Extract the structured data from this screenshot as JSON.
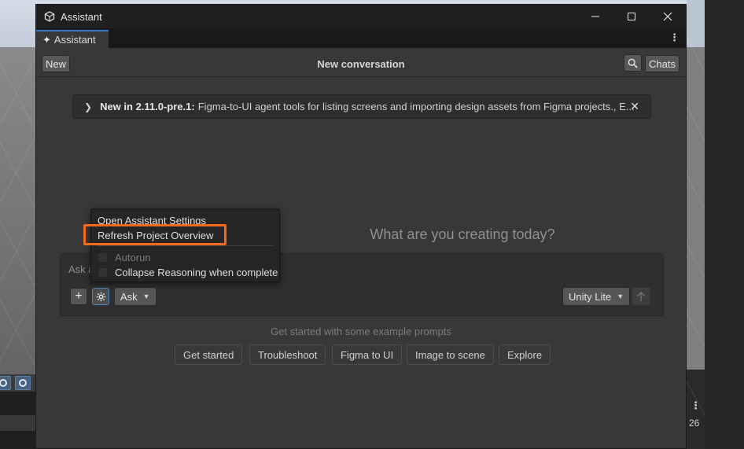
{
  "window": {
    "title": "Assistant",
    "app_icon": "unity-icon",
    "controls": [
      "minimize-icon",
      "maximize-icon",
      "close-icon"
    ]
  },
  "tab": {
    "label": "Assistant",
    "icon": "sparkle-icon",
    "menu_icon": "kebab-menu-icon"
  },
  "header": {
    "new_label": "New",
    "title": "New conversation",
    "search_icon": "search-icon",
    "chats_label": "Chats"
  },
  "notice": {
    "bold": "New in 2.11.0-pre.1:",
    "text": "Figma-to-UI agent tools for listing screens and importing design assets from Figma projects., E...",
    "expand_icon": "chevron-right-icon",
    "close_icon": "close-icon"
  },
  "headline": "What are you creating today?",
  "composer": {
    "placeholder": "Ask a",
    "add_icon": "plus-icon",
    "settings_icon": "gear-icon",
    "mode": "Ask",
    "model": "Unity Lite",
    "send_icon": "arrow-up-icon"
  },
  "examples": {
    "label": "Get started with some example prompts",
    "buttons": [
      "Get started",
      "Troubleshoot",
      "Figma to UI",
      "Image to scene",
      "Explore"
    ]
  },
  "menu": {
    "items": [
      "Open Assistant Settings",
      "Refresh Project Overview"
    ],
    "checks": [
      {
        "label": "Autorun",
        "enabled": false,
        "checked": false
      },
      {
        "label": "Collapse Reasoning when complete",
        "enabled": true,
        "checked": false
      }
    ],
    "highlight_color": "#f26a1c"
  },
  "background": {
    "right_menu": "⋮",
    "right_number": "26"
  },
  "colors": {
    "accent": "#3a78c8",
    "highlight": "#f26a1c"
  }
}
